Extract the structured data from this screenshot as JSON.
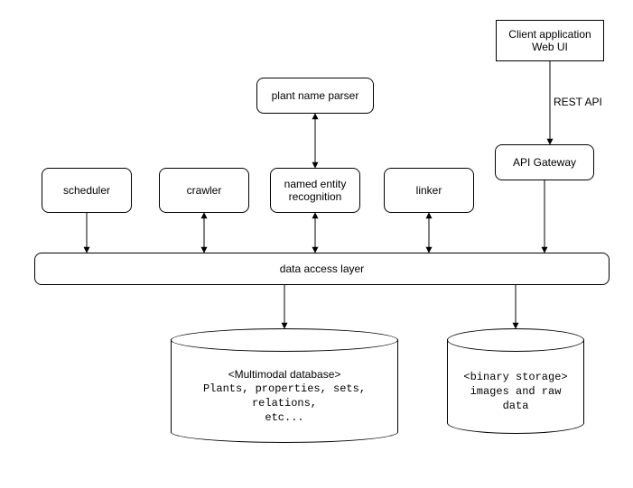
{
  "boxes": {
    "client": {
      "line1": "Client application",
      "line2": "Web UI"
    },
    "parser": "plant name parser",
    "gateway": "API Gateway",
    "scheduler": "scheduler",
    "crawler": "crawler",
    "ner": "named entity\nrecognition",
    "linker": "linker",
    "dal": "data access layer"
  },
  "labels": {
    "rest_api": "REST API"
  },
  "db_multimodal": {
    "header": "<Multimodal database>",
    "line1": "Plants, properties, sets,",
    "line2": "relations,",
    "line3": "etc..."
  },
  "db_binary": {
    "header": "<binary storage>",
    "line1": "images and raw",
    "line2": "data"
  }
}
